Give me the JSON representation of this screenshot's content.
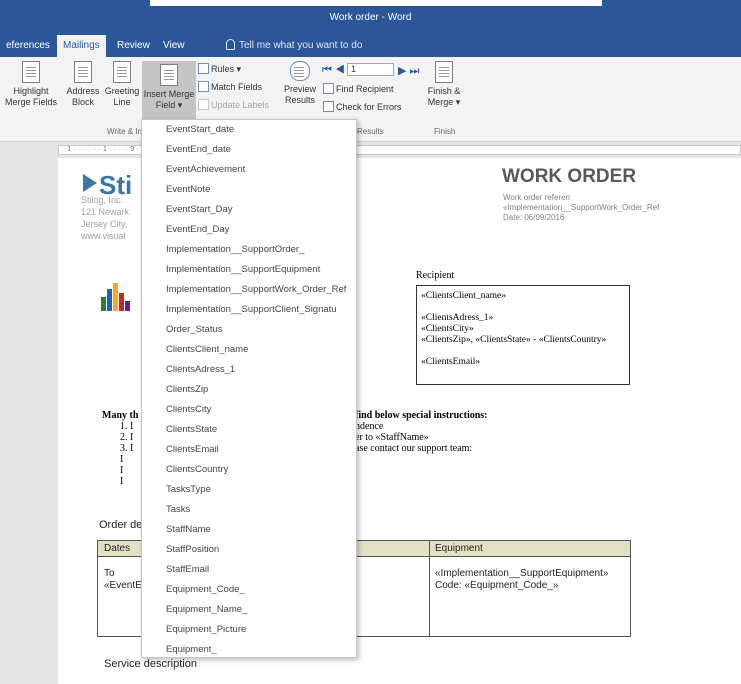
{
  "window": {
    "title": "Work order - Word"
  },
  "tabs": [
    {
      "label": "eferences"
    },
    {
      "label": "Mailings"
    },
    {
      "label": "Review"
    },
    {
      "label": "View"
    }
  ],
  "tellme": {
    "label": "Tell me what you want to do"
  },
  "ribbon": {
    "highlight": {
      "line1": "Highlight",
      "line2": "Merge Fields"
    },
    "address": {
      "line1": "Address",
      "line2": "Block"
    },
    "greeting": {
      "line1": "Greeting",
      "line2": "Line"
    },
    "insert_merge": {
      "line1": "Insert Merge",
      "line2": "Field ▾"
    },
    "rules": "Rules ▾",
    "match_fields": "Match Fields",
    "update_labels": "Update Labels",
    "preview": {
      "line1": "Preview",
      "line2": "Results"
    },
    "record_number": "1",
    "find_recipient": "Find Recipient",
    "check_errors": "Check for Errors",
    "finish": {
      "line1": "Finish &",
      "line2": "Merge ▾"
    },
    "group_write": "Write & In",
    "group_results": "Results",
    "group_finish": "Finish"
  },
  "ruler": {
    "text": "· 1 · ·  · · · · · 1 · · · ·                                                · 9 · · 10 · · 11 · · 12 · · 13 · · 14 · · 15 · · 16 · · 17 · · 18 · · 19 · · 20"
  },
  "document": {
    "logo_text": "Sti",
    "company_lines": [
      "Stilog, Inc.",
      "121 Newark",
      "Jersey City,",
      "www.visual"
    ],
    "title": "WORK ORDER",
    "ref_lines": [
      "Work                  order                  referen",
      "«Implementation__SupportWork_Order_Ref",
      "Date: 06/09/2016"
    ],
    "recipient_label": "Recipient",
    "recipient_lines": [
      "«ClientsClient_name»",
      "",
      "«ClientsAdress_1»",
      "«ClientsCity»",
      "«ClientsZip», «ClientsState» - «ClientsCountry»",
      "",
      "«ClientsEmail»"
    ],
    "many_thanks": "Many th",
    "instructions_bold": "find below special instructions:",
    "instructions_lines": [
      "ndence",
      "er to «StaffName»",
      "ase contact our support team:"
    ],
    "num_list": [
      "1.  I",
      "2.  I",
      "3.  I",
      "     I",
      "     I",
      "     I"
    ],
    "order_details": "Order de",
    "table": {
      "col_dates": "Dates",
      "col_equipment": "Equipment",
      "dates_line1": "To",
      "dates_line2": "«EventE",
      "equip_line1": "«Implementation__SupportEquipment»",
      "equip_line2": "Code: «Equipment_Code_»"
    },
    "service": "Service description"
  },
  "dropdown": {
    "items": [
      "EventStart_date",
      "EventEnd_date",
      "EventAchievement",
      "EventNote",
      "EventStart_Day",
      "EventEnd_Day",
      "Implementation__SupportOrder_",
      "Implementation__SupportEquipment",
      "Implementation__SupportWork_Order_Ref",
      "Implementation__SupportClient_Signatu",
      "Order_Status",
      "ClientsClient_name",
      "ClientsAdress_1",
      "ClientsZip",
      "ClientsCity",
      "ClientsState",
      "ClientsEmail",
      "ClientsCountry",
      "TasksType",
      "Tasks",
      "StaffName",
      "StaffPosition",
      "StaffEmail",
      "Equipment_Code_",
      "Equipment_Name_",
      "Equipment_Picture",
      "Equipment_"
    ]
  },
  "colors": {
    "accent": "#2b579a",
    "ribbon_bg": "#f3f3f3",
    "table_header": "#e4e0c6"
  }
}
